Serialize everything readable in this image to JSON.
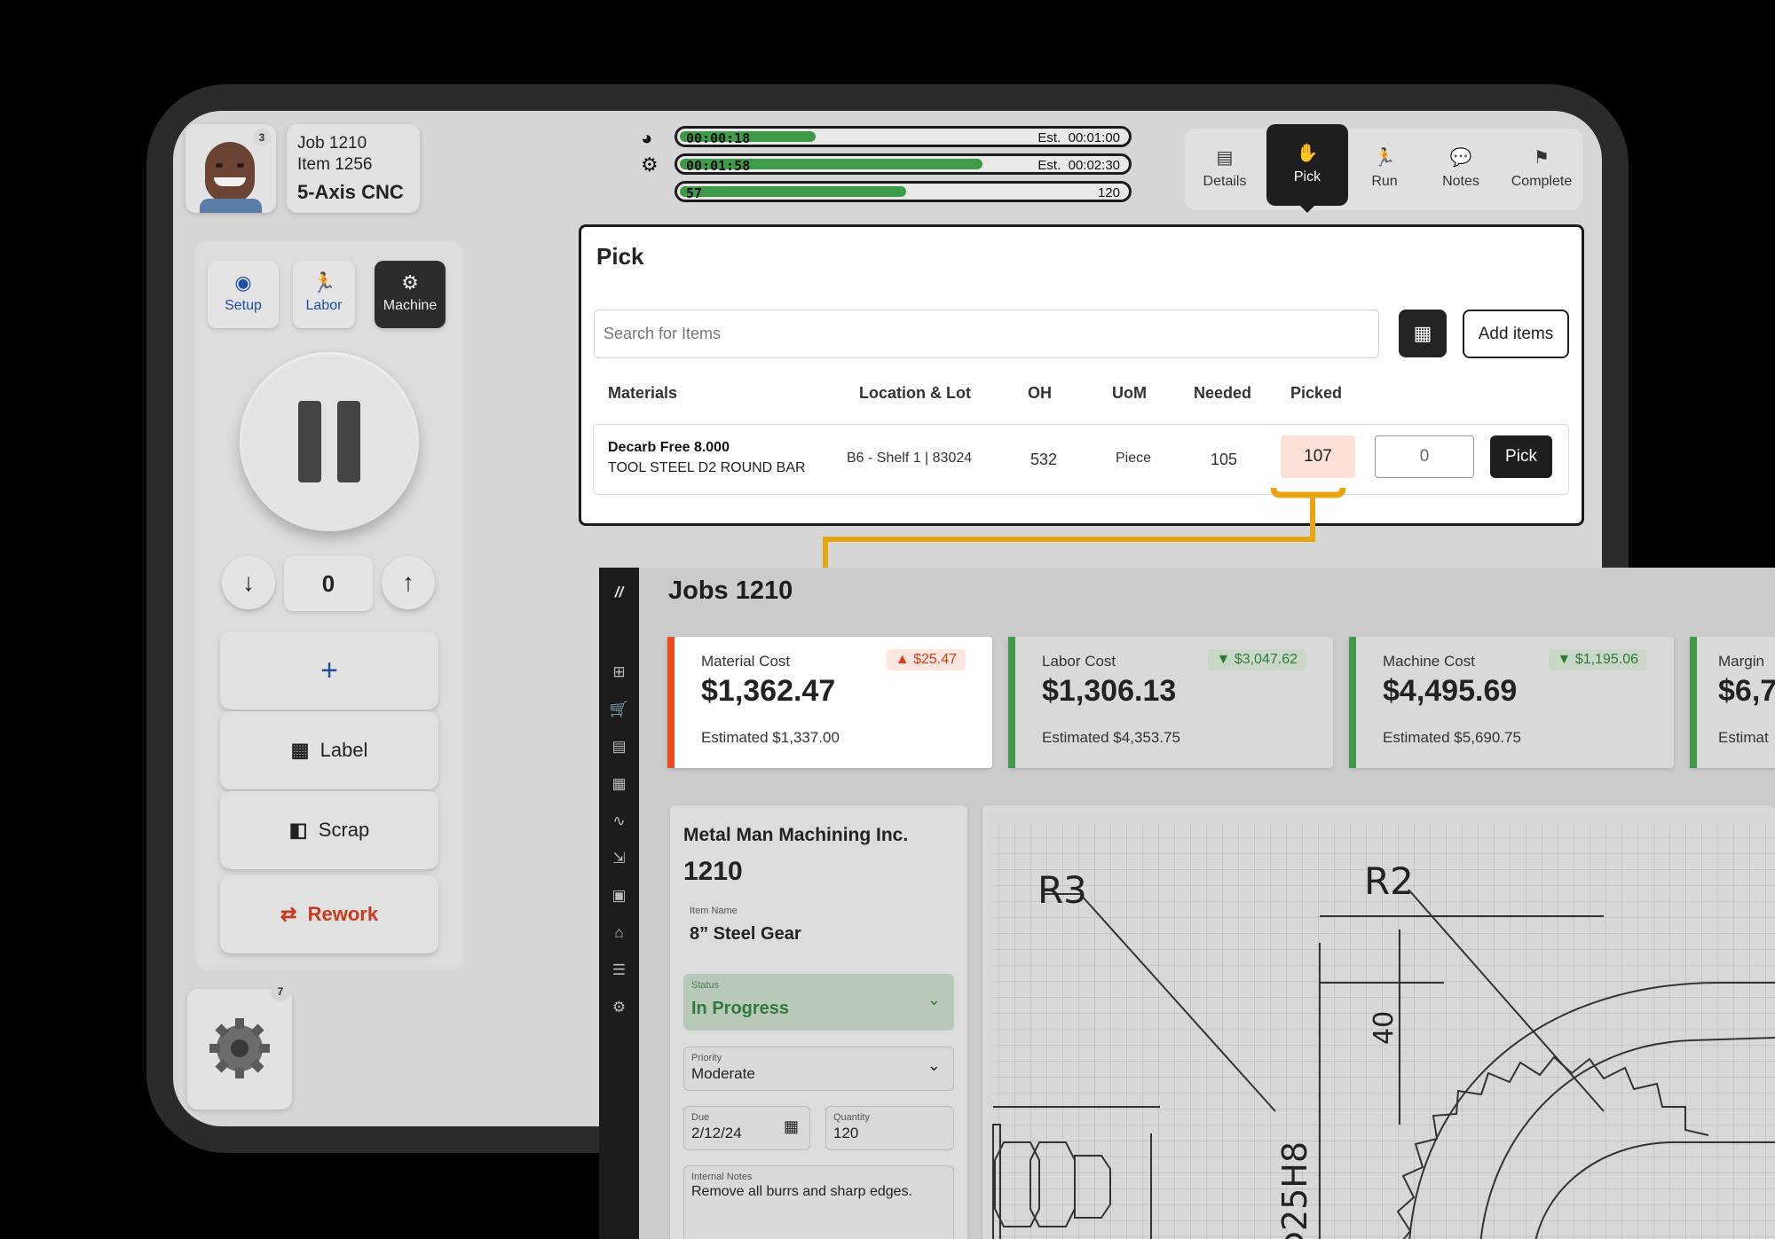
{
  "operator": {
    "badge": "3"
  },
  "job": {
    "job_line": "Job 1210",
    "item_line": "Item 1256",
    "machine": "5-Axis CNC"
  },
  "timers": [
    {
      "elapsed": "00:00:18",
      "est_label": "Est.",
      "est": "00:01:00",
      "progress": 0.3,
      "icon": "stopwatch-icon"
    },
    {
      "elapsed": "00:01:58",
      "est_label": "Est.",
      "est": "00:02:30",
      "progress": 0.67,
      "icon": "gears-icon"
    },
    {
      "elapsed": "57",
      "est_label": "",
      "est": "120",
      "progress": 0.5,
      "icon": ""
    }
  ],
  "tabs": [
    {
      "label": "Details",
      "icon": "details-icon"
    },
    {
      "label": "Pick",
      "icon": "hand-icon"
    },
    {
      "label": "Run",
      "icon": "run-icon"
    },
    {
      "label": "Notes",
      "icon": "chat-icon"
    },
    {
      "label": "Complete",
      "icon": "flag-icon"
    }
  ],
  "modes": [
    {
      "label": "Setup",
      "icon": "setup-icon"
    },
    {
      "label": "Labor",
      "icon": "labor-icon"
    },
    {
      "label": "Machine",
      "icon": "machine-icon"
    }
  ],
  "controls": {
    "counter": "0",
    "add": "+",
    "label": "Label",
    "scrap": "Scrap",
    "rework": "Rework"
  },
  "part_badge": "7",
  "pick": {
    "title": "Pick",
    "search_placeholder": "Search for Items",
    "add_items": "Add items",
    "headers": {
      "materials": "Materials",
      "location": "Location & Lot",
      "oh": "OH",
      "uom": "UoM",
      "needed": "Needed",
      "picked": "Picked"
    },
    "row": {
      "name": "Decarb Free 8.000",
      "desc": "TOOL STEEL D2 ROUND BAR",
      "location": "B6 - Shelf 1 | 83024",
      "oh": "532",
      "uom": "Piece",
      "needed": "105",
      "picked": "107",
      "qty": "0",
      "button": "Pick"
    }
  },
  "jobs": {
    "title": "Jobs  1210",
    "costs": [
      {
        "label": "Material Cost",
        "value": "$1,362.47",
        "delta": "▲ $25.47",
        "estimated": "Estimated $1,337.00",
        "color": "#f04b1c"
      },
      {
        "label": "Labor Cost",
        "value": "$1,306.13",
        "delta": "▼ $3,047.62",
        "estimated": "Estimated $4,353.75",
        "color": "#3f9a4a"
      },
      {
        "label": "Machine Cost",
        "value": "$4,495.69",
        "delta": "▼ $1,195.06",
        "estimated": "Estimated $5,690.75",
        "color": "#3f9a4a"
      },
      {
        "label": "Margin",
        "value": "$6,7",
        "delta": "",
        "estimated": "Estimat",
        "color": "#3f9a4a"
      }
    ],
    "customer": "Metal Man Machining Inc.",
    "job_no": "1210",
    "item_name_label": "Item Name",
    "item_name": "8” Steel Gear",
    "status_label": "Status",
    "status": "In Progress",
    "priority_label": "Priority",
    "priority": "Moderate",
    "due_label": "Due",
    "due": "2/12/24",
    "qty_label": "Quantity",
    "qty": "120",
    "notes_label": "Internal Notes",
    "notes": "Remove all burrs and sharp edges."
  },
  "drawing": {
    "r3": "R3",
    "r2": "R2",
    "dim40": "40",
    "dia": "Φ25H8"
  }
}
